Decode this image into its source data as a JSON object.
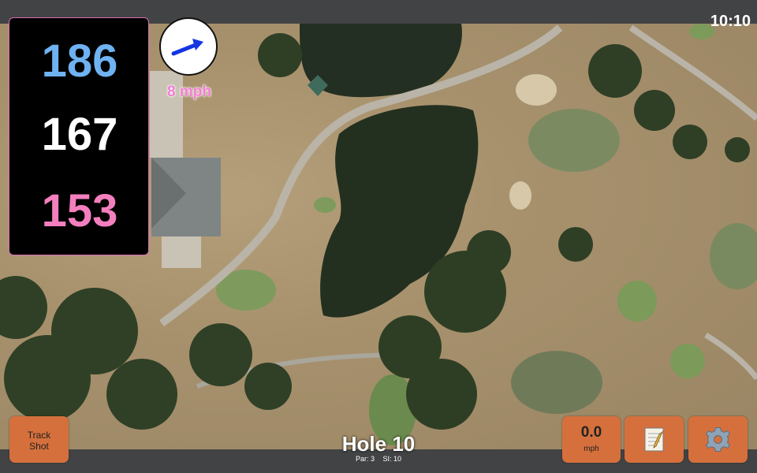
{
  "status_bar": {
    "time": "10:10"
  },
  "distances": {
    "back": "186",
    "middle": "167",
    "front": "153",
    "colors": {
      "back": "#6fb2f2",
      "middle": "#ffffff",
      "front": "#f47fbe"
    }
  },
  "wind": {
    "speed_label": "8 mph",
    "arrow_icon": "arrow-right-icon"
  },
  "hole": {
    "title": "Hole 10",
    "par": "Par: 3",
    "si": "SI: 10"
  },
  "buttons": {
    "track_shot_line1": "Track",
    "track_shot_line2": "Shot",
    "speed_value": "0.0",
    "speed_unit": "mph",
    "notes_icon": "notepad-icon",
    "settings_icon": "gear-icon"
  },
  "colors": {
    "button": "#d5703d",
    "bars": "#424345"
  }
}
